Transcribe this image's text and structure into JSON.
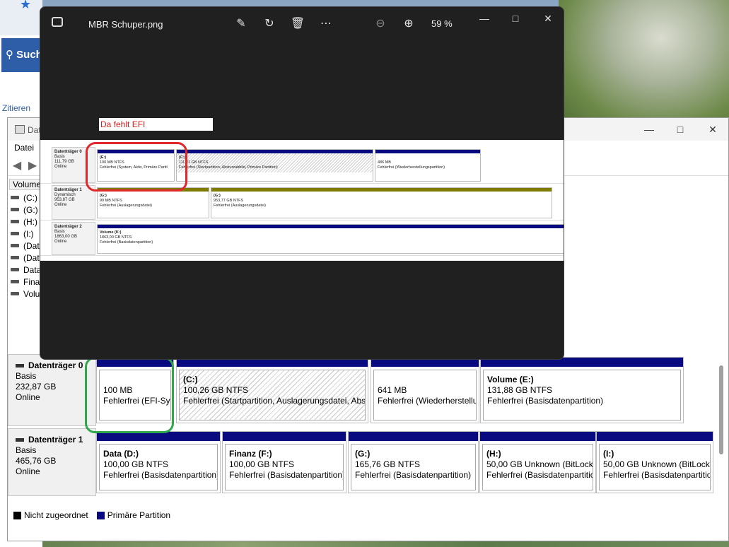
{
  "browser": {
    "search_label": "Such",
    "zitieren_label": "Zitieren"
  },
  "viewer": {
    "filename": "MBR Schuper.png",
    "zoom": "59 %",
    "annotation": "Da fehlt EFI",
    "disks": [
      {
        "name": "Datenträger 0",
        "type": "Basis",
        "size": "111,79 GB",
        "status": "Online",
        "partitions": [
          {
            "title": "(E:)",
            "size": "100 MB NTFS",
            "status": "Fehlerfrei (System, Aktiv, Primäre Partit",
            "bar": "#0a0a80",
            "hatch": false
          },
          {
            "title": "(C:)",
            "size": "111,21 GB NTFS",
            "status": "Fehlerfrei (Startpartition, Absturzabbild, Primäre Partition)",
            "bar": "#0a0a80",
            "hatch": true
          },
          {
            "title": "",
            "size": "486 MB",
            "status": "Fehlerfrei (Wiederherstellungspartition)",
            "bar": "#0a0a80",
            "hatch": false
          }
        ]
      },
      {
        "name": "Datenträger 1",
        "type": "Dynamisch",
        "size": "953,87 GB",
        "status": "Online",
        "partitions": [
          {
            "title": "(G:)",
            "size": "99 MB NTFS",
            "status": "Fehlerfrei (Auslagerungsdatei)",
            "bar": "#7f7a00",
            "hatch": false
          },
          {
            "title": "(G:)",
            "size": "953,77 GB NTFS",
            "status": "Fehlerfrei (Auslagerungsdatei)",
            "bar": "#7f7a00",
            "hatch": false
          }
        ]
      },
      {
        "name": "Datenträger 2",
        "type": "Basis",
        "size": "1863,00 GB",
        "status": "Online",
        "partitions": [
          {
            "title": "Volume (K:)",
            "size": "1863,00 GB NTFS",
            "status": "Fehlerfrei (Basisdatenpartition)",
            "bar": "#0a0a80",
            "hatch": false
          }
        ]
      }
    ]
  },
  "diskmgmt": {
    "title": "Dat",
    "menu_datei": "Datei",
    "volume_header": "Volume",
    "volumes": [
      "(C:)",
      "(G:)",
      "(H:)",
      "(I:)",
      "(Date",
      "(Date",
      "Data",
      "Finar",
      "Volu"
    ],
    "disks": [
      {
        "name": "Datenträger 0",
        "type": "Basis",
        "size": "232,87 GB",
        "status": "Online",
        "partitions": [
          {
            "title": "",
            "size": "100 MB",
            "status": "Fehlerfrei (EFI-Syst",
            "hatch": false
          },
          {
            "title": "(C:)",
            "size": "100,26 GB NTFS",
            "status": "Fehlerfrei (Startpartition, Auslagerungsdatei, Abstu",
            "hatch": true
          },
          {
            "title": "",
            "size": "641 MB",
            "status": "Fehlerfrei (Wiederherstellu",
            "hatch": false
          },
          {
            "title": "Volume  (E:)",
            "size": "131,88 GB NTFS",
            "status": "Fehlerfrei (Basisdatenpartition)",
            "hatch": false
          }
        ]
      },
      {
        "name": "Datenträger 1",
        "type": "Basis",
        "size": "465,76 GB",
        "status": "Online",
        "partitions": [
          {
            "title": "Data  (D:)",
            "size": "100,00 GB NTFS",
            "status": "Fehlerfrei (Basisdatenpartition)",
            "hatch": false
          },
          {
            "title": "Finanz  (F:)",
            "size": "100,00 GB NTFS",
            "status": "Fehlerfrei (Basisdatenpartition)",
            "hatch": false
          },
          {
            "title": "(G:)",
            "size": "165,76 GB NTFS",
            "status": "Fehlerfrei (Basisdatenpartition)",
            "hatch": false
          },
          {
            "title": "(H:)",
            "size": "50,00 GB Unknown (BitLocke",
            "status": "Fehlerfrei (Basisdatenpartition)",
            "hatch": false
          },
          {
            "title": "(I:)",
            "size": "50,00 GB Unknown (BitLocke",
            "status": "Fehlerfrei (Basisdatenpartition)",
            "hatch": false
          }
        ]
      }
    ],
    "legend": [
      {
        "label": "Nicht zugeordnet",
        "color": "#000000"
      },
      {
        "label": "Primäre Partition",
        "color": "#0a0a80"
      }
    ]
  }
}
